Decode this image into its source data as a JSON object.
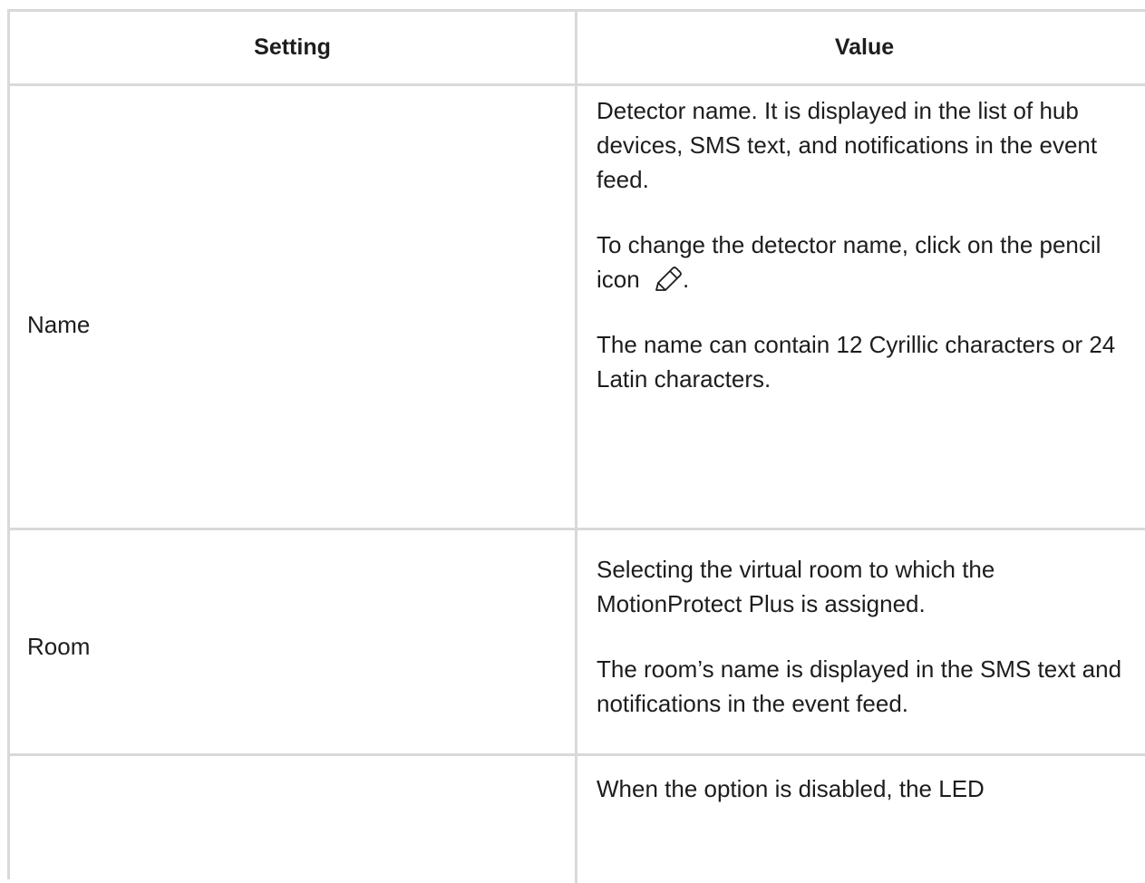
{
  "table": {
    "headers": {
      "setting": "Setting",
      "value": "Value"
    },
    "rows": [
      {
        "setting": "Name",
        "value_paragraphs": [
          "Detector name. It is displayed in the list of hub devices, SMS text, and notifications in the event feed.",
          "To change the detector name, click on the pencil icon",
          "The name can contain 12 Cyrillic characters or 24 Latin characters."
        ],
        "icon": "pencil-icon",
        "after_icon_text": "."
      },
      {
        "setting": "Room",
        "value_paragraphs": [
          "Selecting the virtual room to which the MotionProtect Plus is assigned.",
          "The room’s name is displayed in the SMS text and notifications in the event feed."
        ]
      },
      {
        "setting": "",
        "value_paragraphs": [
          "When the option is disabled, the LED"
        ]
      }
    ]
  },
  "colors": {
    "border": "#d9d9d9",
    "text": "#1d1d1f",
    "background": "#ffffff"
  }
}
